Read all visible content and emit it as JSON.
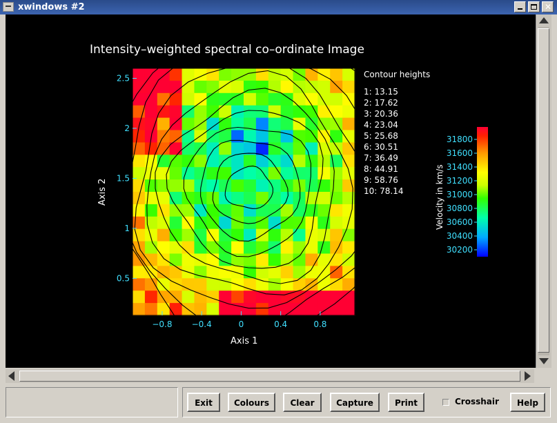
{
  "window": {
    "title": "xwindows #2"
  },
  "plot": {
    "title": "Intensity–weighted spectral co–ordinate Image",
    "x_axis_label": "Axis 1",
    "y_axis_label": "Axis 2",
    "x_ticks": [
      "−0.8",
      "−0.4",
      "0",
      "0.4",
      "0.8"
    ],
    "y_ticks": [
      "0.5",
      "1",
      "1.5",
      "2",
      "2.5"
    ],
    "contour_title": "Contour heights",
    "contours": [
      "1: 13.15",
      "2: 17.62",
      "3: 20.36",
      "4: 23.04",
      "5: 25.68",
      "6: 30.51",
      "7: 36.49",
      "8: 44.91",
      "9: 58.76",
      "10: 78.14"
    ],
    "colorbar_label": "Velocity in km/s",
    "colorbar_ticks": [
      "31800",
      "31600",
      "31400",
      "31200",
      "31000",
      "30800",
      "30600",
      "30400",
      "30200"
    ]
  },
  "buttons": {
    "exit": "Exit",
    "colours": "Colours",
    "clear": "Clear",
    "capture": "Capture",
    "print": "Print",
    "help": "Help"
  },
  "crosshair": {
    "label": "Crosshair",
    "checked": false
  },
  "colors": {
    "title_bar": "#3c64b0",
    "canvas_bg": "#000000",
    "tick_cyan": "#40e0ff"
  }
}
